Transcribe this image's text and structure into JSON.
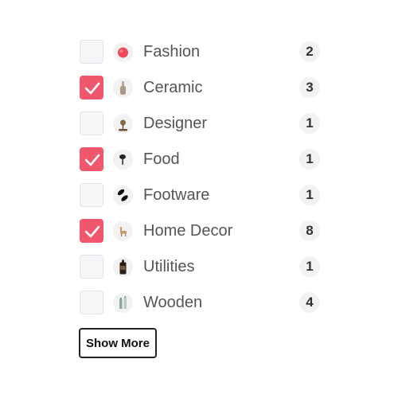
{
  "filters": [
    {
      "label": "Fashion",
      "count": "2",
      "checked": false,
      "icon": "fashion-red-ball-icon"
    },
    {
      "label": "Ceramic",
      "count": "3",
      "checked": true,
      "icon": "ceramic-vase-icon"
    },
    {
      "label": "Designer",
      "count": "1",
      "checked": false,
      "icon": "designer-lamp-icon"
    },
    {
      "label": "Food",
      "count": "1",
      "checked": true,
      "icon": "food-spoon-icon"
    },
    {
      "label": "Footware",
      "count": "1",
      "checked": false,
      "icon": "footware-shoes-icon"
    },
    {
      "label": "Home Decor",
      "count": "8",
      "checked": true,
      "icon": "home-decor-llama-icon"
    },
    {
      "label": "Utilities",
      "count": "1",
      "checked": false,
      "icon": "utilities-bottle-icon"
    },
    {
      "label": "Wooden",
      "count": "4",
      "checked": false,
      "icon": "wooden-bottles-icon"
    }
  ],
  "show_more_label": "Show More",
  "colors": {
    "accent": "#f0566c",
    "unchecked_bg": "#f5f6f8",
    "label_text": "#555555",
    "count_bg": "#f2f2f2"
  }
}
